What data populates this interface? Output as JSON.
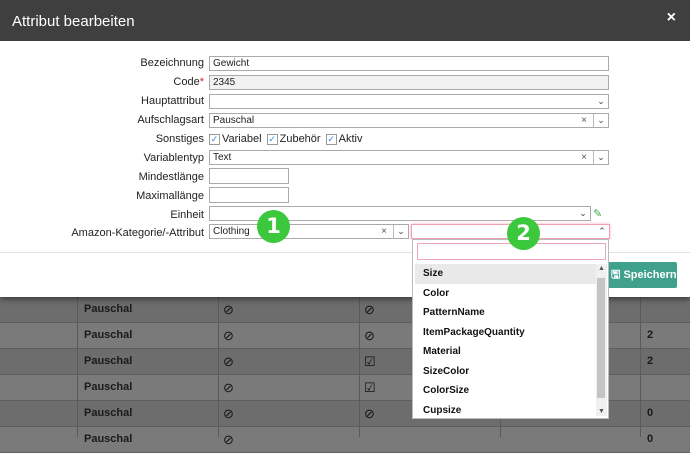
{
  "background_table": {
    "rows": [
      {
        "col1": "Pauschal",
        "sym2": "⊘",
        "sym3": "⊘",
        "col5": ""
      },
      {
        "col1": "Pauschal",
        "sym2": "⊘",
        "sym3": "⊘",
        "col5": "2"
      },
      {
        "col1": "Pauschal",
        "sym2": "⊘",
        "sym3": "☑",
        "col5": "2"
      },
      {
        "col1": "Pauschal",
        "sym2": "⊘",
        "sym3": "☑",
        "col5": ""
      },
      {
        "col1": "Pauschal",
        "sym2": "⊘",
        "sym3": "⊘",
        "col5": "0"
      },
      {
        "col1": "Pauschal",
        "sym2": "⊘",
        "sym3": "",
        "col5": "0"
      }
    ]
  },
  "modal": {
    "title": "Attribut bearbeiten",
    "close_icon": "×",
    "fields": {
      "bezeichnung": {
        "label": "Bezeichnung",
        "value": "Gewicht"
      },
      "code": {
        "label": "Code",
        "required_mark": "*",
        "value": "2345"
      },
      "hauptattribut": {
        "label": "Hauptattribut",
        "value": ""
      },
      "aufschlagsart": {
        "label": "Aufschlagsart",
        "value": "Pauschal"
      },
      "sonstiges": {
        "label": "Sonstiges",
        "options": [
          "Variabel",
          "Zubehör",
          "Aktiv"
        ]
      },
      "variablentyp": {
        "label": "Variablentyp",
        "value": "Text"
      },
      "mindestlaenge": {
        "label": "Mindestlänge",
        "value": ""
      },
      "maximallaenge": {
        "label": "Maximallänge",
        "value": ""
      },
      "einheit": {
        "label": "Einheit",
        "value": ""
      },
      "amazon": {
        "label": "Amazon-Kategorie/-Attribut",
        "category": "Clothing",
        "attribute": ""
      }
    },
    "save_label": "Speichern",
    "badges": [
      "1",
      "2"
    ]
  },
  "dropdown": {
    "options": [
      "Size",
      "Color",
      "PatternName",
      "ItemPackageQuantity",
      "Material",
      "SizeColor",
      "ColorSize",
      "Cupsize"
    ],
    "highlighted": "Size"
  },
  "icons": {
    "clear": "×",
    "chevron_down": "⌄",
    "chevron_up": "⌃",
    "pencil": "✎",
    "check": "✓",
    "save": "🖫"
  }
}
